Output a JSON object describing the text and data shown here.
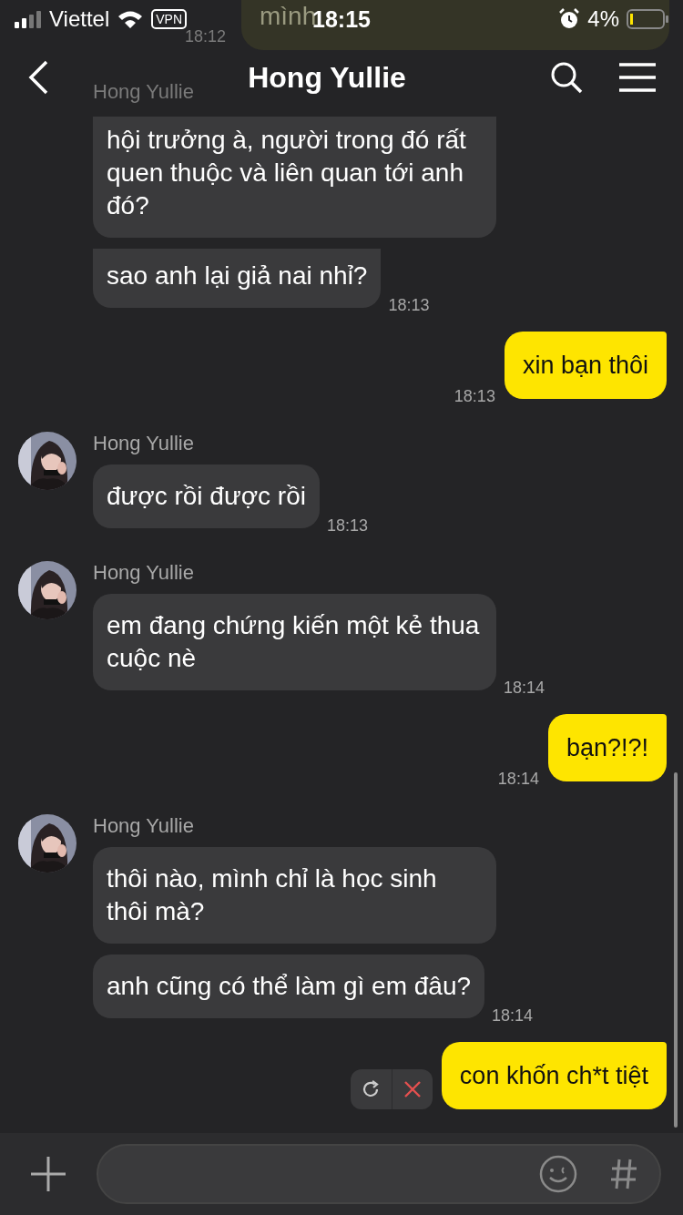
{
  "status_bar": {
    "carrier": "Viettel",
    "vpn": "VPN",
    "time": "18:15",
    "battery": "4%"
  },
  "behind_header": {
    "bubble_text": "mình",
    "time": "18:12",
    "sender": "Hong Yullie"
  },
  "header": {
    "title": "Hong Yullie"
  },
  "messages": [
    {
      "kind": "incoming",
      "bubbles": [
        "hội trưởng à, người trong đó rất quen thuộc và liên quan tới anh đó?",
        "sao anh lại giả nai nhỉ?"
      ],
      "time": "18:13"
    },
    {
      "kind": "outgoing",
      "bubbles": [
        "xin bạn thôi"
      ],
      "time": "18:13",
      "failed": false
    },
    {
      "kind": "incoming",
      "sender": "Hong Yullie",
      "bubbles": [
        "được rồi được rồi"
      ],
      "time": "18:13"
    },
    {
      "kind": "incoming",
      "sender": "Hong Yullie",
      "bubbles": [
        "em đang chứng kiến một kẻ thua cuộc nè"
      ],
      "time": "18:14"
    },
    {
      "kind": "outgoing",
      "bubbles": [
        "bạn?!?!"
      ],
      "time": "18:14",
      "failed": false
    },
    {
      "kind": "incoming",
      "sender": "Hong Yullie",
      "bubbles": [
        "thôi nào, mình chỉ là học sinh thôi mà?",
        "anh cũng có thể làm gì em đâu?"
      ],
      "time": "18:14"
    },
    {
      "kind": "outgoing",
      "bubbles": [
        "con khốn ch*t tiệt"
      ],
      "failed": true
    }
  ]
}
